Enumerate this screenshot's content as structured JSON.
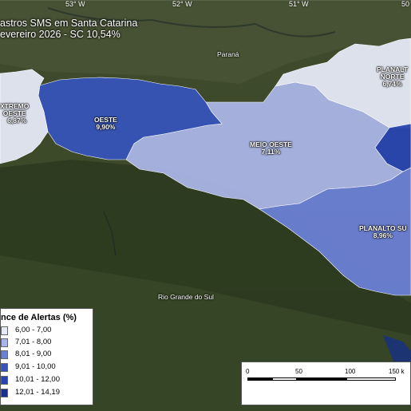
{
  "title": {
    "line1": "astros SMS em Santa Catarina",
    "line2": "evereiro 2026 - SC 10,54%"
  },
  "longitude_ticks": [
    "53° W",
    "52° W",
    "51° W",
    "50"
  ],
  "places": {
    "parana": "Paraná",
    "rio_grande_do_sul": "Rio Grande do Sul"
  },
  "regions": [
    {
      "id": "extremo-oeste",
      "name": "XTREMO\nOESTE",
      "value": "6,87%",
      "color": "#e6e9f7"
    },
    {
      "id": "oeste",
      "name": "OESTE",
      "value": "9,90%",
      "color": "#3653b8"
    },
    {
      "id": "meio-oeste",
      "name": "MEIO OESTE",
      "value": "7,11%",
      "color": "#aab4e6"
    },
    {
      "id": "planalto-norte",
      "name": "PLANALT\nNORTE",
      "value": "6,74%",
      "color": "#e6e9f7"
    },
    {
      "id": "planalto-sul",
      "name": "PLANALTO SU",
      "value": "8,96%",
      "color": "#6a80d4"
    },
    {
      "id": "norte-east",
      "name": "",
      "value": "",
      "color": "#2844b0"
    }
  ],
  "legend": {
    "title": "nce de Alertas (%)",
    "items": [
      {
        "label": "6,00 - 7,00",
        "color": "#e6e9f7"
      },
      {
        "label": "7,01 - 8,00",
        "color": "#aab4e6"
      },
      {
        "label": "8,01 - 9,00",
        "color": "#6a80d4"
      },
      {
        "label": "9,01 - 10,00",
        "color": "#3653b8"
      },
      {
        "label": "10,01 - 12,00",
        "color": "#2844b0"
      },
      {
        "label": "12,01 - 14,19",
        "color": "#1a2f8e"
      }
    ]
  },
  "scale": {
    "labels": [
      "0",
      "50",
      "100",
      "150 k"
    ]
  }
}
